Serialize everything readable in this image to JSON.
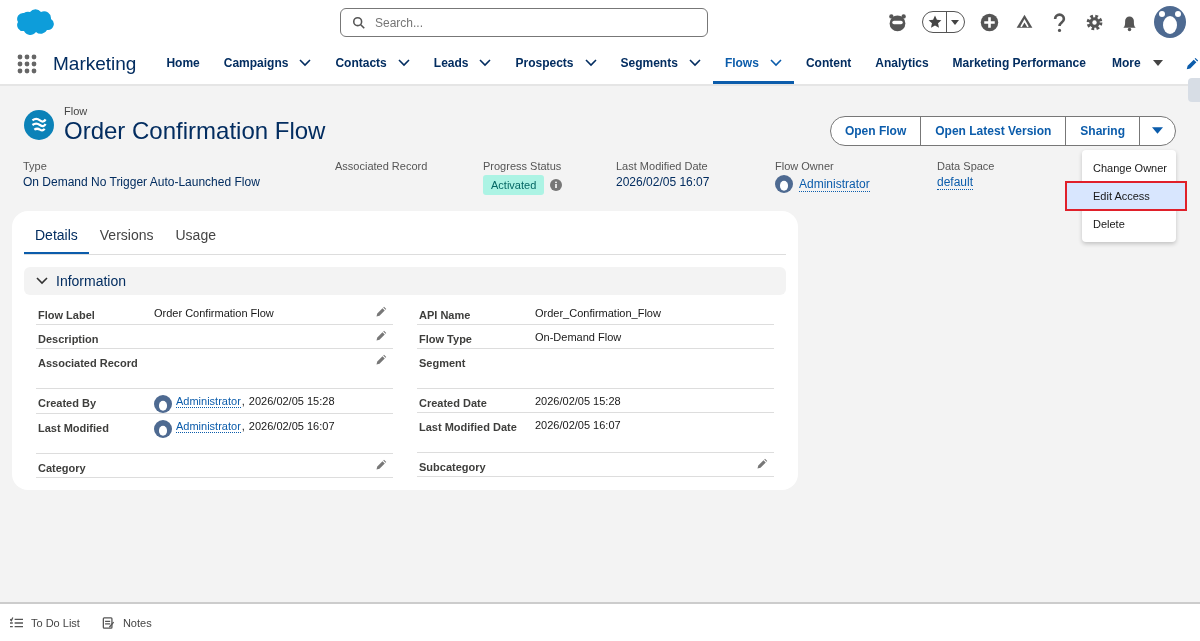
{
  "header": {
    "search": {
      "placeholder": "Search..."
    }
  },
  "nav": {
    "app_name": "Marketing",
    "items": [
      {
        "label": "Home",
        "has_menu": false,
        "selected": false
      },
      {
        "label": "Campaigns",
        "has_menu": true,
        "selected": false
      },
      {
        "label": "Contacts",
        "has_menu": true,
        "selected": false
      },
      {
        "label": "Leads",
        "has_menu": true,
        "selected": false
      },
      {
        "label": "Prospects",
        "has_menu": true,
        "selected": false
      },
      {
        "label": "Segments",
        "has_menu": true,
        "selected": false
      },
      {
        "label": "Flows",
        "has_menu": true,
        "selected": true
      },
      {
        "label": "Content",
        "has_menu": false,
        "selected": false
      },
      {
        "label": "Analytics",
        "has_menu": false,
        "selected": false
      },
      {
        "label": "Marketing Performance",
        "has_menu": false,
        "selected": false
      }
    ],
    "more": "More"
  },
  "record": {
    "object": "Flow",
    "title": "Order Confirmation Flow",
    "actions": [
      "Open Flow",
      "Open Latest Version",
      "Sharing"
    ],
    "menu": [
      {
        "label": "Change Owner",
        "selected": false,
        "outlined": false
      },
      {
        "label": "Edit Access",
        "selected": true,
        "outlined": true
      },
      {
        "label": "Delete",
        "selected": false,
        "outlined": false
      }
    ],
    "highlights": [
      {
        "kind": "text",
        "label": "Type",
        "value": "On Demand No Trigger Auto-Launched Flow"
      },
      {
        "kind": "empty",
        "label": "Associated Record"
      },
      {
        "kind": "badge",
        "label": "Progress Status",
        "value": "Activated"
      },
      {
        "kind": "text",
        "label": "Last Modified Date",
        "value": "2026/02/05 16:07"
      },
      {
        "kind": "user",
        "label": "Flow Owner",
        "value": "Administrator"
      },
      {
        "kind": "link",
        "label": "Data Space",
        "value": "default"
      }
    ]
  },
  "tabs": [
    {
      "label": "Details",
      "selected": true
    },
    {
      "label": "Versions",
      "selected": false
    },
    {
      "label": "Usage",
      "selected": false
    }
  ],
  "section": {
    "title": "Information",
    "expanded": true,
    "columns": [
      [
        {
          "kind": "text",
          "label": "Flow Label",
          "value": "Order Confirmation Flow",
          "editable": true
        },
        {
          "kind": "text",
          "label": "Description",
          "editable": true
        },
        {
          "kind": "text",
          "label": "Associated Record",
          "editable": true
        },
        {
          "kind": "user",
          "label": "Created By",
          "user": "Administrator",
          "separator": ",",
          "value": "2026/02/05 15:28",
          "editable": false
        },
        {
          "kind": "user",
          "label": "Last Modified",
          "user": "Administrator",
          "separator": ",",
          "value": "2026/02/05 16:07",
          "editable": false
        },
        {
          "kind": "text",
          "label": "Category",
          "editable": true
        }
      ],
      [
        {
          "kind": "text",
          "label": "API Name",
          "value": "Order_Confirmation_Flow",
          "editable": false
        },
        {
          "kind": "text",
          "label": "Flow Type",
          "value": "On-Demand Flow",
          "editable": false
        },
        {
          "kind": "text",
          "label": "Segment",
          "editable": false
        },
        {
          "kind": "text",
          "label": "Created Date",
          "value": "2026/02/05 15:28",
          "editable": false
        },
        {
          "kind": "text",
          "label": "Last Modified Date",
          "value": "2026/02/05 16:07",
          "editable": false
        },
        {
          "kind": "text",
          "label": "Subcategory",
          "editable": true
        }
      ]
    ]
  },
  "utility_bar": [
    "To Do List",
    "Notes"
  ]
}
